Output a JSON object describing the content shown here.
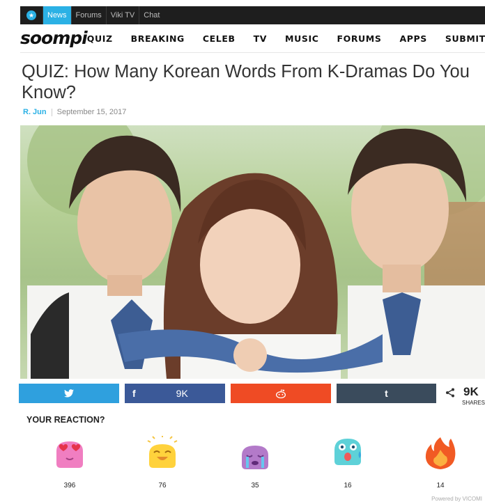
{
  "topbar": {
    "tabs": [
      "News",
      "Forums",
      "Viki TV",
      "Chat"
    ],
    "active_tab": "News"
  },
  "nav": {
    "brand": "soompi",
    "items": [
      "QUIZ",
      "BREAKING",
      "CELEB",
      "TV",
      "MUSIC",
      "FORUMS",
      "APPS",
      "SUBMIT TIP"
    ]
  },
  "article": {
    "title": "QUIZ: How Many Korean Words From K-Dramas Do You Know?",
    "author": "R. Jun",
    "date": "September 15, 2017"
  },
  "share": {
    "facebook_count": "9K",
    "total_count": "9K",
    "total_label": "SHARES"
  },
  "reactions": {
    "title": "YOUR REACTION?",
    "items": [
      {
        "name": "love",
        "count": "396"
      },
      {
        "name": "laugh",
        "count": "76"
      },
      {
        "name": "sad",
        "count": "35"
      },
      {
        "name": "shocked",
        "count": "16"
      },
      {
        "name": "fire",
        "count": "14"
      }
    ]
  },
  "footer": {
    "powered": "Powered by VICOMI"
  },
  "colors": {
    "accent": "#2bb1e5",
    "twitter": "#2fa0de",
    "facebook": "#3b5998",
    "reddit": "#ef4b24",
    "tumblr": "#3a4b5c"
  }
}
